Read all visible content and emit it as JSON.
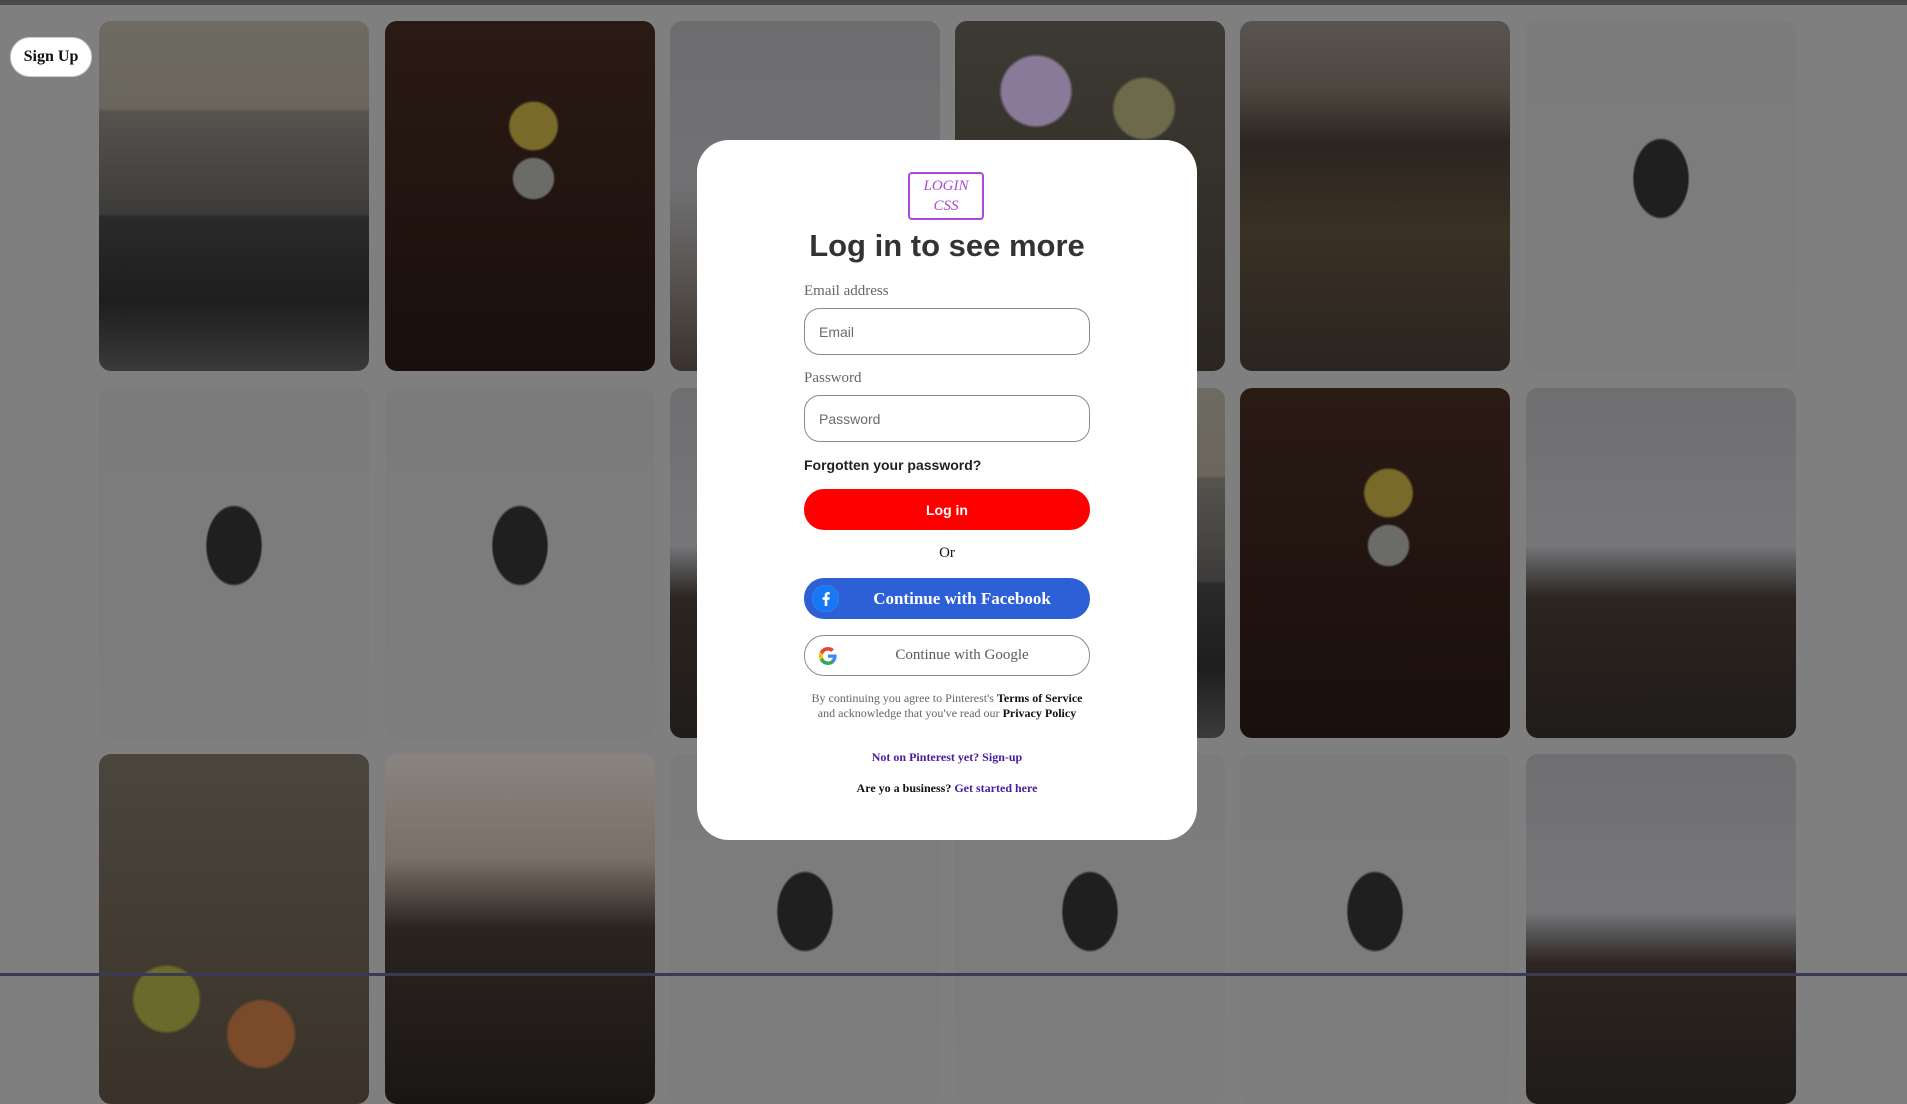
{
  "header": {
    "signup_label": "Sign Up"
  },
  "grid": {
    "tiles": [
      {
        "photo": "cafe"
      },
      {
        "photo": "dark-flower"
      },
      {
        "photo": "sky"
      },
      {
        "photo": "flowers"
      },
      {
        "photo": "canyon"
      },
      {
        "photo": "witch"
      },
      {
        "photo": "witch"
      },
      {
        "photo": "witch"
      },
      {
        "photo": "horses"
      },
      {
        "photo": "cafe"
      },
      {
        "photo": "dark-flower"
      },
      {
        "photo": "horses"
      },
      {
        "photo": "gourds"
      },
      {
        "photo": "mountain"
      },
      {
        "photo": "witch"
      },
      {
        "photo": "witch"
      },
      {
        "photo": "witch"
      },
      {
        "photo": "horses"
      }
    ]
  },
  "modal": {
    "logo_line1": "LOGIN",
    "logo_line2": "CSS",
    "title": "Log in to see more",
    "email_label": "Email address",
    "email_placeholder": "Email",
    "email_value": "",
    "password_label": "Password",
    "password_placeholder": "Password",
    "password_value": "",
    "forgot_label": "Forgotten your password?",
    "login_label": "Log in",
    "or_label": "Or",
    "facebook_label": "Continue with Facebook",
    "google_label": "Continue with Google",
    "terms_prefix": "By continuing you agree to Pinterest's",
    "terms_link": "Terms of Service",
    "terms_middle": "and acknowledge that you've read our",
    "privacy_link": "Privacy Policy",
    "not_on_label": "Not on Pinterest yet? Sign-up",
    "business_prefix": "Are yo a business?",
    "business_link": "Get started here"
  },
  "colors": {
    "login_button": "#ff0000",
    "facebook_button": "#2d5fd6",
    "logo_accent": "#a94bd8",
    "link": "#4a1b9e",
    "overlay": "#7f7f7f"
  },
  "icons": {
    "facebook": "facebook-f-icon",
    "google": "google-g-icon"
  }
}
